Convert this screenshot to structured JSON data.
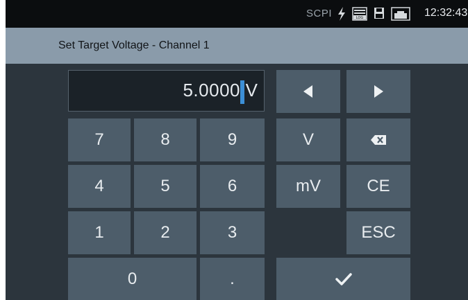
{
  "status_bar": {
    "scpi_label": "SCPI",
    "icons": [
      "flash-icon",
      "log-icon",
      "save-icon",
      "network-icon"
    ],
    "time": "12:32:43"
  },
  "dialog": {
    "title": "Set Target Voltage - Channel 1"
  },
  "entry": {
    "value": "5.0000",
    "unit": "V"
  },
  "keypad": {
    "k7": "7",
    "k8": "8",
    "k9": "9",
    "k4": "4",
    "k5": "5",
    "k6": "6",
    "k1": "1",
    "k2": "2",
    "k3": "3",
    "k0": "0",
    "kdot": ".",
    "unit_v": "V",
    "unit_mv": "mV",
    "ce": "CE",
    "esc": "ESC"
  },
  "icons": {
    "left": "arrow-left-icon",
    "right": "arrow-right-icon",
    "backspace": "backspace-icon",
    "confirm": "checkmark-icon"
  },
  "colors": {
    "key": "#4d5d6a",
    "background": "#2c353d",
    "title_bar": "#8a9baa",
    "cursor": "#3c8fd6"
  }
}
